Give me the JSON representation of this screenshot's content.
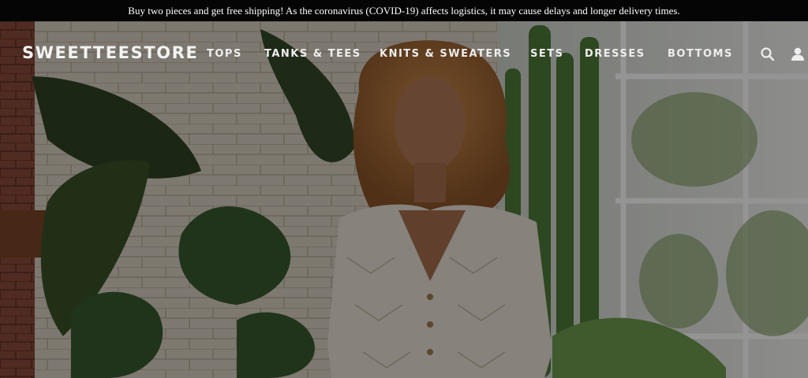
{
  "announcement": {
    "text": "Buy two pieces and get free shipping! As the coronavirus (COVID-19) affects logistics, it may cause delays and longer delivery times."
  },
  "header": {
    "logo": "SWEETTEESTORE",
    "menu": [
      {
        "label": "TOPS"
      },
      {
        "label": "TANKS & TEES"
      },
      {
        "label": "KNITS & SWEATERS"
      },
      {
        "label": "SETS"
      },
      {
        "label": "DRESSES"
      },
      {
        "label": "BOTTOMS"
      }
    ],
    "icons": {
      "search": "search-icon",
      "account": "user-icon"
    }
  },
  "colors": {
    "announcement_bg": "#050505",
    "nav_text": "#eeeeee",
    "hero_overlay": "#000000"
  }
}
